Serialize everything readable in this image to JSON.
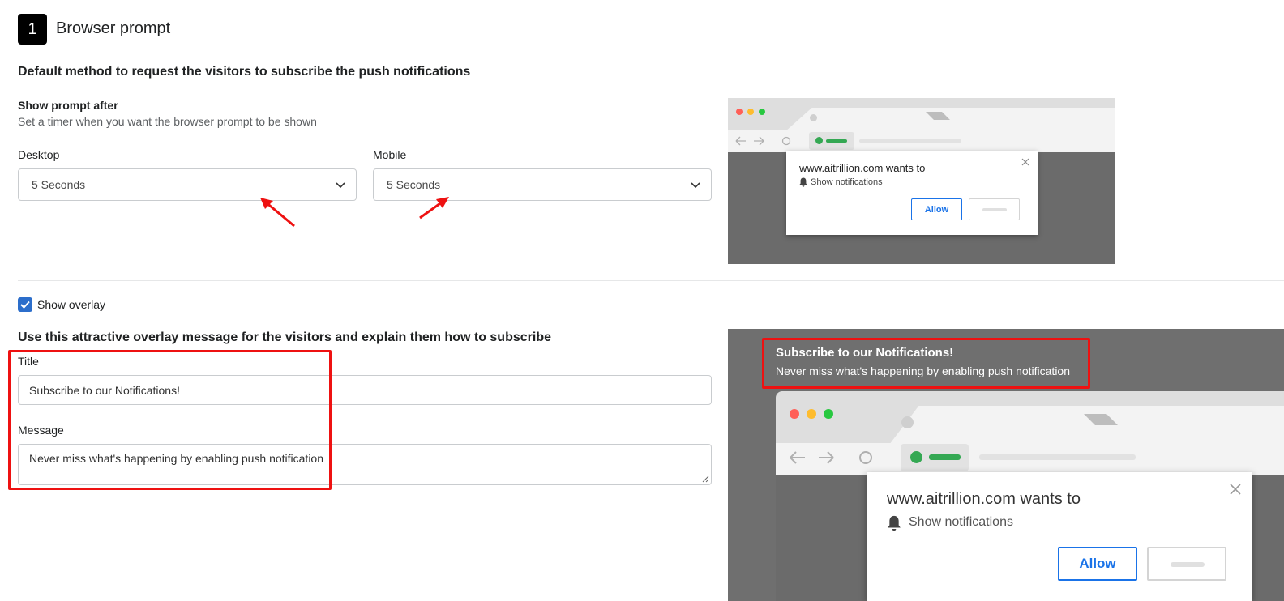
{
  "header": {
    "step_number": "1",
    "title": "Browser prompt"
  },
  "prompt_section": {
    "description": "Default method to request the visitors to subscribe the push notifications",
    "show_prompt_label": "Show prompt after",
    "show_prompt_help": "Set a timer when you want the browser prompt to be shown",
    "desktop": {
      "label": "Desktop",
      "value": "5 Seconds"
    },
    "mobile": {
      "label": "Mobile",
      "value": "5 Seconds"
    }
  },
  "overlay_section": {
    "checkbox_label": "Show overlay",
    "checked": true,
    "description": "Use this attractive overlay message for the visitors and explain them how to subscribe",
    "title_field": {
      "label": "Title",
      "value": "Subscribe to our Notifications!"
    },
    "message_field": {
      "label": "Message",
      "value": "Never miss what's happening by enabling push notification"
    }
  },
  "preview_small": {
    "site_text": "www.aitrillion.com wants to",
    "permission_text": "Show notifications",
    "allow_label": "Allow"
  },
  "preview_large": {
    "overlay_title": "Subscribe to our Notifications!",
    "overlay_message": "Never miss what's happening by enabling push notification",
    "site_text": "www.aitrillion.com wants to",
    "permission_text": "Show notifications",
    "allow_label": "Allow"
  },
  "colors": {
    "accent": "#2c6ecb",
    "annotation_red": "#ee1111",
    "allow_blue": "#1a73e8",
    "traffic_red": "#ff5f57",
    "traffic_yellow": "#febc2e",
    "traffic_green": "#28c840",
    "lock_green": "#34a853"
  }
}
